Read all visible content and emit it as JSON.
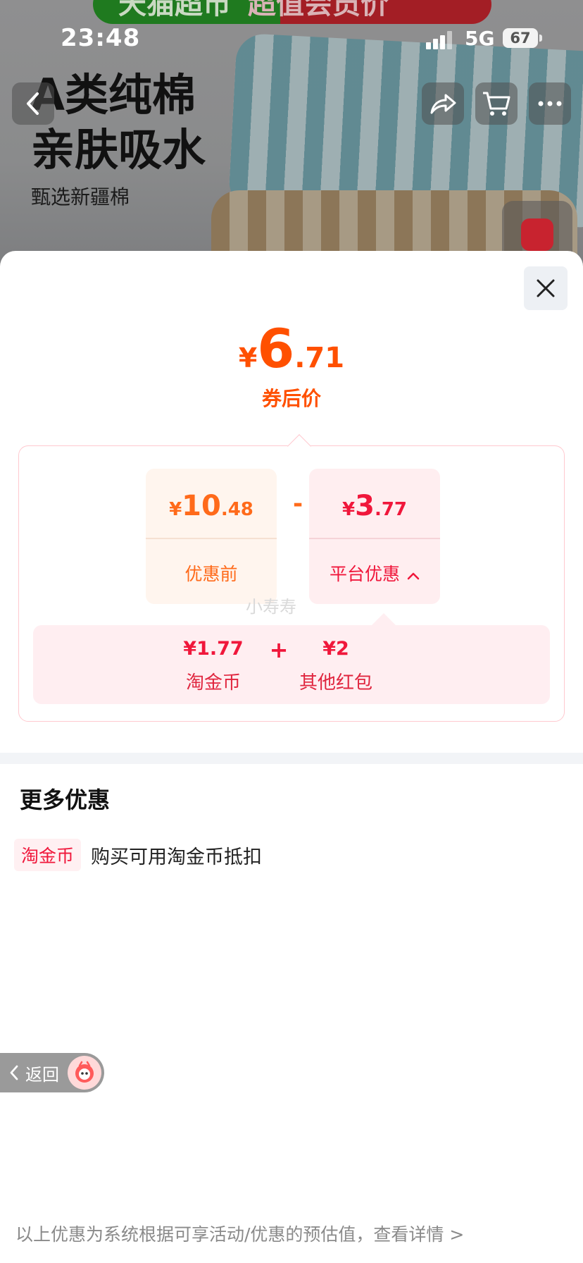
{
  "status_bar": {
    "time": "23:48",
    "network": "5G",
    "battery": "67"
  },
  "background_page": {
    "banner_left": "天猫超市",
    "banner_right": "超值会员价",
    "headline_lines": [
      "A类纯棉",
      "亲肤吸水"
    ],
    "subline": "甄选新疆棉"
  },
  "price_sheet": {
    "final_price": {
      "currency": "¥",
      "integer": "6",
      "decimal": ".71",
      "label": "券后价"
    },
    "before_discount": {
      "currency": "¥",
      "integer": "10",
      "decimal": ".48",
      "label": "优惠前"
    },
    "operator": "-",
    "platform_discount": {
      "currency": "¥",
      "integer": "3",
      "decimal": ".77",
      "label": "平台优惠"
    },
    "watermark": "小寿寿",
    "breakdown": {
      "plus": "+",
      "items": [
        {
          "value": "¥1.77",
          "name": "淘金币"
        },
        {
          "value": "¥2",
          "name": "其他红包"
        }
      ]
    }
  },
  "more_offers": {
    "title": "更多优惠",
    "items": [
      {
        "tag": "淘金币",
        "text": "购买可用淘金币抵扣"
      }
    ]
  },
  "back_float": {
    "label": "返回"
  },
  "footnote": "以上优惠为系统根据可享活动/优惠的预估值，查看详情 >",
  "colors": {
    "accent_orange": "#ff5000",
    "accent_red": "#f0173b"
  },
  "icons": [
    "back-chevron-icon",
    "share-icon",
    "cart-icon",
    "more-icon",
    "close-icon",
    "chevron-up-icon",
    "assistant-avatar-icon"
  ]
}
